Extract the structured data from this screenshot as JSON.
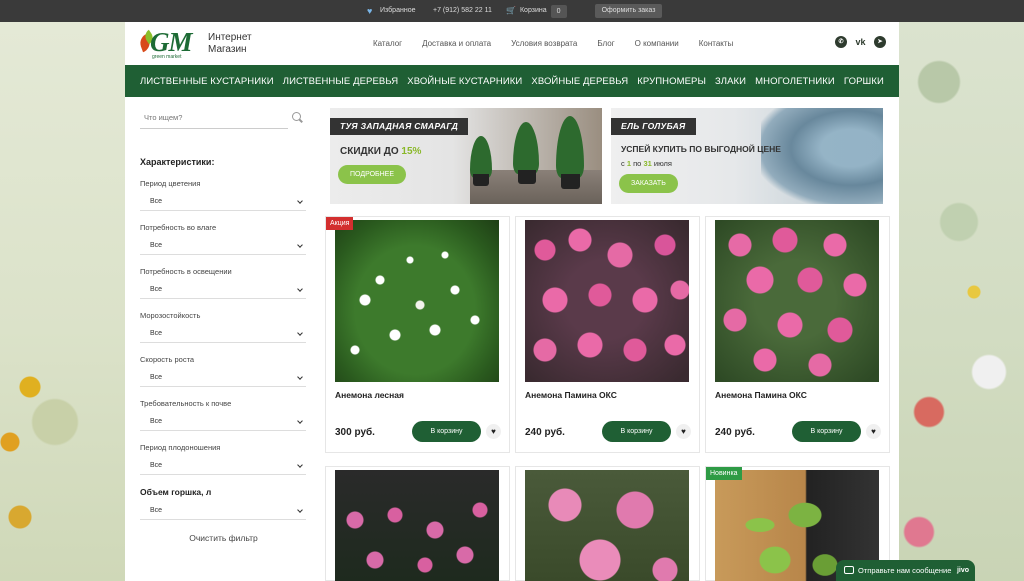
{
  "topbar": {
    "favorites_label": "Избранное",
    "phone": "+7 (912) 582 22 11",
    "cart_label": "Корзина",
    "cart_count": "0",
    "order_button": "Оформить заказ"
  },
  "header": {
    "logo_mark": "GM",
    "logo_sub": "green market",
    "logo_text_line1": "Интернет",
    "logo_text_line2": "Магазин",
    "nav": [
      "Каталог",
      "Доставка и оплата",
      "Условия возврата",
      "Блог",
      "О компании",
      "Контакты"
    ],
    "social": [
      "whatsapp-icon",
      "vk-icon",
      "telegram-icon"
    ]
  },
  "categories": [
    "ЛИСТВЕННЫЕ КУСТАРНИКИ",
    "ЛИСТВЕННЫЕ ДЕРЕВЬЯ",
    "ХВОЙНЫЕ КУСТАРНИКИ",
    "ХВОЙНЫЕ ДЕРЕВЬЯ",
    "КРУПНОМЕРЫ",
    "ЗЛАКИ",
    "МНОГОЛЕТНИКИ",
    "ГОРШКИ"
  ],
  "sidebar": {
    "search_placeholder": "Что ищем?",
    "filters_title": "Характеристики:",
    "filters": [
      {
        "label": "Период цветения",
        "value": "Все"
      },
      {
        "label": "Потребность во влаге",
        "value": "Все"
      },
      {
        "label": "Потребность в освещении",
        "value": "Все"
      },
      {
        "label": "Морозостойкость",
        "value": "Все"
      },
      {
        "label": "Скорость роста",
        "value": "Все"
      },
      {
        "label": "Требовательность к почве",
        "value": "Все"
      },
      {
        "label": "Период плодоношения",
        "value": "Все"
      },
      {
        "label": "Объем горшка, л",
        "value": "Все"
      }
    ],
    "clear_filter": "Очистить фильтр"
  },
  "banners": [
    {
      "tag": "ТУЯ ЗАПАДНАЯ СМАРАГД",
      "headline": "СКИДКИ ДО",
      "accent": "15%",
      "button": "ПОДРОБНЕЕ"
    },
    {
      "tag": "ЕЛЬ ГОЛУБАЯ",
      "headline": "УСПЕЙ КУПИТЬ ПО ВЫГОДНОЙ ЦЕНЕ",
      "sub_prefix": "с",
      "sub_from": "1",
      "sub_mid": "по",
      "sub_to": "31",
      "sub_suffix": "июля",
      "button": "ЗАКАЗАТЬ"
    }
  ],
  "products": [
    {
      "badge": "Акция",
      "name": "Анемона лесная",
      "price": "300 руб.",
      "cart_button": "В корзину"
    },
    {
      "badge": "",
      "name": "Анемона Памина ОКС",
      "price": "240 руб.",
      "cart_button": "В корзину"
    },
    {
      "badge": "",
      "name": "Анемона Памина ОКС",
      "price": "240 руб.",
      "cart_button": "В корзину"
    },
    {
      "badge": "",
      "name": "",
      "price": "",
      "cart_button": ""
    },
    {
      "badge": "",
      "name": "",
      "price": "",
      "cart_button": ""
    },
    {
      "badge": "Новинка",
      "name": "",
      "price": "",
      "cart_button": ""
    }
  ],
  "chat": {
    "label": "Отправьте нам сообщение",
    "brand": "jivo"
  }
}
